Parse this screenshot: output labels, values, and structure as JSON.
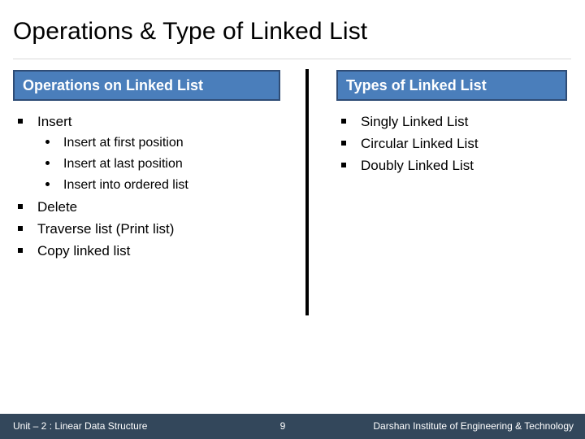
{
  "slide": {
    "title": "Operations & Type of Linked List",
    "colors": {
      "header_fill": "#4A7EBB",
      "header_border": "#2F4C75",
      "footer_bar": "#33475B",
      "title_rule": "#D9D9D9",
      "divider": "#000000",
      "text": "#000000",
      "header_text": "#FFFFFF"
    }
  },
  "columns": {
    "left": {
      "header": "Operations on Linked List",
      "items": [
        {
          "label": "Insert",
          "children": [
            {
              "label": "Insert at first position"
            },
            {
              "label": "Insert at last position"
            },
            {
              "label": "Insert into ordered list"
            }
          ]
        },
        {
          "label": "Delete",
          "children": []
        },
        {
          "label": "Traverse list (Print list)",
          "children": []
        },
        {
          "label": "Copy linked list",
          "children": []
        }
      ]
    },
    "right": {
      "header": "Types of Linked List",
      "items": [
        {
          "label": "Singly Linked List",
          "children": []
        },
        {
          "label": "Circular Linked List",
          "children": []
        },
        {
          "label": "Doubly Linked List",
          "children": []
        }
      ]
    }
  },
  "footer": {
    "left": "Unit – 2 : Linear Data Structure",
    "page": "9",
    "right": "Darshan Institute of Engineering & Technology"
  }
}
